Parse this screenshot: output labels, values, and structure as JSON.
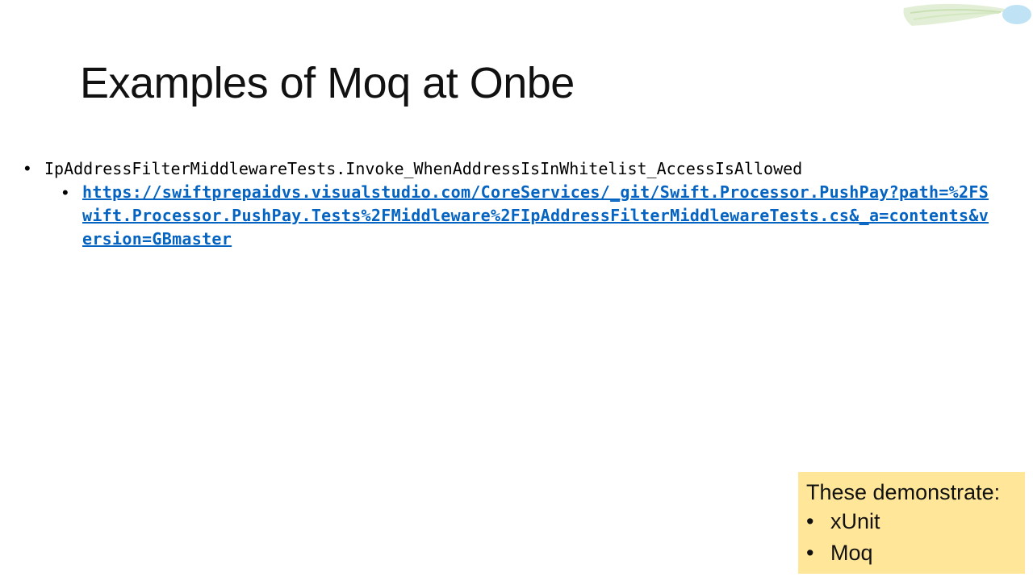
{
  "slide": {
    "title": "Examples of Moq at Onbe",
    "bullets": [
      {
        "text": "IpAddressFilterMiddlewareTests.Invoke_WhenAddressIsInWhitelist_AccessIsAllowed",
        "sub": [
          {
            "link": "https://swiftprepaidvs.visualstudio.com/CoreServices/_git/Swift.Processor.PushPay?path=%2FSwift.Processor.PushPay.Tests%2FMiddleware%2FIpAddressFilterMiddlewareTests.cs&_a=contents&version=GBmaster"
          }
        ]
      }
    ],
    "callout": {
      "heading": "These demonstrate:",
      "items": [
        "xUnit",
        "Moq"
      ]
    },
    "bullet_glyph": "•",
    "colors": {
      "link": "#0563c1",
      "callout_bg": "#ffe699",
      "deco_green": "#d9ead3",
      "deco_blue": "#bfe3f5"
    }
  }
}
